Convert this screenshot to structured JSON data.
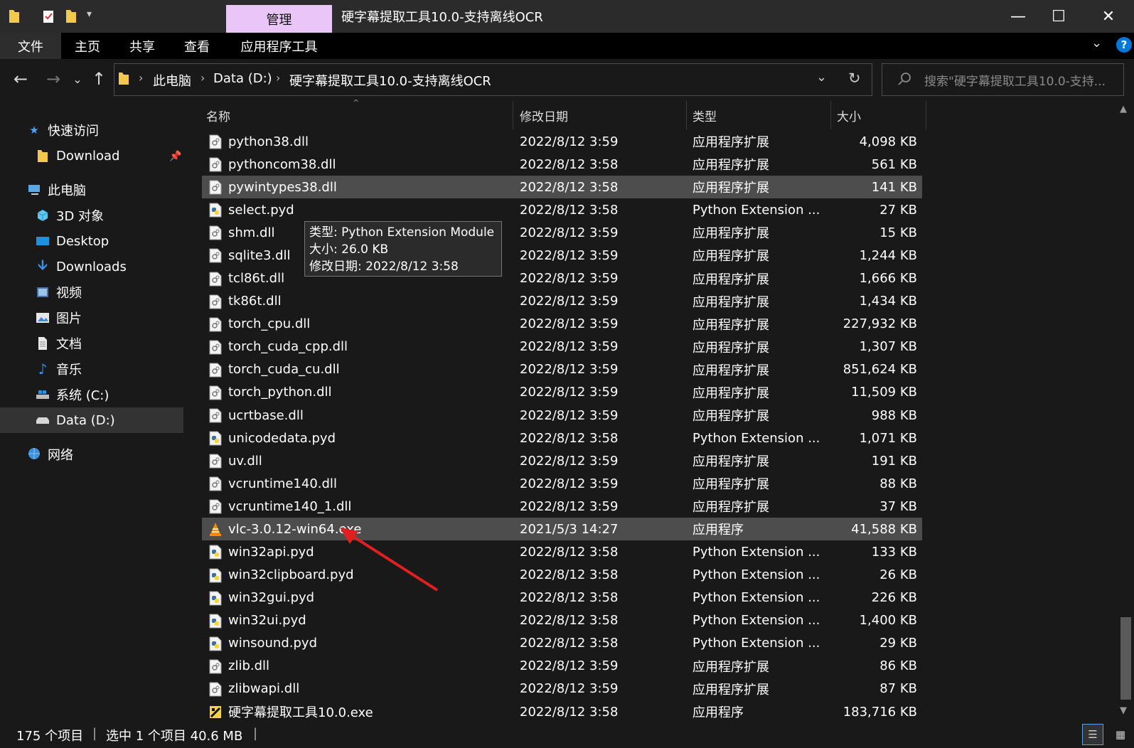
{
  "window": {
    "title": "硬字幕提取工具10.0-支持离线OCR",
    "manage_tab": "管理",
    "controls": [
      "minimize",
      "maximize",
      "close"
    ]
  },
  "ribbon": {
    "tabs": [
      "文件",
      "主页",
      "共享",
      "查看",
      "应用程序工具"
    ]
  },
  "address": {
    "crumbs": [
      "此电脑",
      "Data (D:)",
      "硬字幕提取工具10.0-支持离线OCR"
    ],
    "search_placeholder": "搜索\"硬字幕提取工具10.0-支持..."
  },
  "sidebar": {
    "items": [
      {
        "label": "快速访问",
        "icon": "star-icon"
      },
      {
        "label": "Download",
        "icon": "folder-icon",
        "pinned": true
      },
      {
        "label": "此电脑",
        "icon": "computer-icon"
      },
      {
        "label": "3D 对象",
        "icon": "cube-icon"
      },
      {
        "label": "Desktop",
        "icon": "desktop-icon"
      },
      {
        "label": "Downloads",
        "icon": "download-arrow-icon"
      },
      {
        "label": "视频",
        "icon": "video-icon"
      },
      {
        "label": "图片",
        "icon": "picture-icon"
      },
      {
        "label": "文档",
        "icon": "document-icon"
      },
      {
        "label": "音乐",
        "icon": "music-icon"
      },
      {
        "label": "系统 (C:)",
        "icon": "drive-c-icon"
      },
      {
        "label": "Data (D:)",
        "icon": "drive-d-icon",
        "selected": true
      },
      {
        "label": "网络",
        "icon": "network-icon"
      }
    ]
  },
  "columns": {
    "name": "名称",
    "date": "修改日期",
    "type": "类型",
    "size": "大小"
  },
  "files": [
    {
      "name": "python38.dll",
      "date": "2022/8/12 3:59",
      "type": "应用程序扩展",
      "size": "4,098 KB",
      "icon": "dll"
    },
    {
      "name": "pythoncom38.dll",
      "date": "2022/8/12 3:58",
      "type": "应用程序扩展",
      "size": "561 KB",
      "icon": "dll"
    },
    {
      "name": "pywintypes38.dll",
      "date": "2022/8/12 3:58",
      "type": "应用程序扩展",
      "size": "141 KB",
      "icon": "dll",
      "hover": true
    },
    {
      "name": "select.pyd",
      "date": "2022/8/12 3:58",
      "type": "Python Extension ...",
      "size": "27 KB",
      "icon": "pyd"
    },
    {
      "name": "shm.dll",
      "date": "2022/8/12 3:59",
      "type": "应用程序扩展",
      "size": "15 KB",
      "icon": "dll"
    },
    {
      "name": "sqlite3.dll",
      "date": "2022/8/12 3:59",
      "type": "应用程序扩展",
      "size": "1,244 KB",
      "icon": "dll"
    },
    {
      "name": "tcl86t.dll",
      "date": "2022/8/12 3:59",
      "type": "应用程序扩展",
      "size": "1,666 KB",
      "icon": "dll"
    },
    {
      "name": "tk86t.dll",
      "date": "2022/8/12 3:59",
      "type": "应用程序扩展",
      "size": "1,434 KB",
      "icon": "dll"
    },
    {
      "name": "torch_cpu.dll",
      "date": "2022/8/12 3:59",
      "type": "应用程序扩展",
      "size": "227,932 KB",
      "icon": "dll"
    },
    {
      "name": "torch_cuda_cpp.dll",
      "date": "2022/8/12 3:59",
      "type": "应用程序扩展",
      "size": "1,307 KB",
      "icon": "dll"
    },
    {
      "name": "torch_cuda_cu.dll",
      "date": "2022/8/12 3:59",
      "type": "应用程序扩展",
      "size": "851,624 KB",
      "icon": "dll"
    },
    {
      "name": "torch_python.dll",
      "date": "2022/8/12 3:59",
      "type": "应用程序扩展",
      "size": "11,509 KB",
      "icon": "dll"
    },
    {
      "name": "ucrtbase.dll",
      "date": "2022/8/12 3:59",
      "type": "应用程序扩展",
      "size": "988 KB",
      "icon": "dll"
    },
    {
      "name": "unicodedata.pyd",
      "date": "2022/8/12 3:58",
      "type": "Python Extension ...",
      "size": "1,071 KB",
      "icon": "pyd"
    },
    {
      "name": "uv.dll",
      "date": "2022/8/12 3:59",
      "type": "应用程序扩展",
      "size": "191 KB",
      "icon": "dll"
    },
    {
      "name": "vcruntime140.dll",
      "date": "2022/8/12 3:59",
      "type": "应用程序扩展",
      "size": "88 KB",
      "icon": "dll"
    },
    {
      "name": "vcruntime140_1.dll",
      "date": "2022/8/12 3:59",
      "type": "应用程序扩展",
      "size": "37 KB",
      "icon": "dll"
    },
    {
      "name": "vlc-3.0.12-win64.exe",
      "date": "2021/5/3 14:27",
      "type": "应用程序",
      "size": "41,588 KB",
      "icon": "vlc",
      "selected": true
    },
    {
      "name": "win32api.pyd",
      "date": "2022/8/12 3:58",
      "type": "Python Extension ...",
      "size": "133 KB",
      "icon": "pyd"
    },
    {
      "name": "win32clipboard.pyd",
      "date": "2022/8/12 3:58",
      "type": "Python Extension ...",
      "size": "26 KB",
      "icon": "pyd"
    },
    {
      "name": "win32gui.pyd",
      "date": "2022/8/12 3:58",
      "type": "Python Extension ...",
      "size": "226 KB",
      "icon": "pyd"
    },
    {
      "name": "win32ui.pyd",
      "date": "2022/8/12 3:58",
      "type": "Python Extension ...",
      "size": "1,400 KB",
      "icon": "pyd"
    },
    {
      "name": "winsound.pyd",
      "date": "2022/8/12 3:58",
      "type": "Python Extension ...",
      "size": "29 KB",
      "icon": "pyd"
    },
    {
      "name": "zlib.dll",
      "date": "2022/8/12 3:59",
      "type": "应用程序扩展",
      "size": "86 KB",
      "icon": "dll"
    },
    {
      "name": "zlibwapi.dll",
      "date": "2022/8/12 3:59",
      "type": "应用程序扩展",
      "size": "87 KB",
      "icon": "dll"
    },
    {
      "name": "硬字幕提取工具10.0.exe",
      "date": "2022/8/12 3:58",
      "type": "应用程序",
      "size": "183,716 KB",
      "icon": "app"
    }
  ],
  "tooltip": {
    "lines": [
      "类型: Python Extension Module",
      "大小: 26.0 KB",
      "修改日期: 2022/8/12 3:58"
    ]
  },
  "status": {
    "count": "175 个项目",
    "selection": "选中 1 个项目  40.6 MB"
  },
  "colors": {
    "manage_tab": "#e9c6f7",
    "selection": "#4d4d4d",
    "annotation_arrow": "#e02020",
    "accent": "#0078d7"
  }
}
